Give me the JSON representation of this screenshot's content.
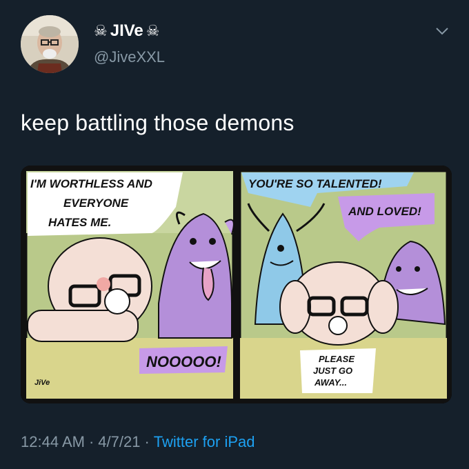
{
  "user": {
    "display_name": "JIVe",
    "name_prefix_icon": "skull-crossbones-icon",
    "name_suffix_icon": "skull-crossbones-icon",
    "handle": "@JiveXXL"
  },
  "tweet": {
    "text": "keep battling those demons"
  },
  "comic": {
    "panel1": {
      "speech_top": [
        "I'M WORTHLESS AND",
        "EVERYONE",
        "HATES ME."
      ],
      "speech_bottom": "NOOOOO!",
      "signature": "JiVe"
    },
    "panel2": {
      "speech_left": "YOU'RE SO TALENTED!",
      "speech_right": "AND LOVED!",
      "speech_bottom": [
        "PLEASE",
        "JUST GO",
        "AWAY..."
      ]
    }
  },
  "meta": {
    "time": "12:44 AM",
    "date": "4/7/21",
    "separator": "·",
    "source": "Twitter for iPad"
  },
  "colors": {
    "background": "#15202b",
    "secondary_text": "#8899a6",
    "link": "#1da1f2",
    "demon_purple": "#b48fd9",
    "demon_blue": "#8fc9e8",
    "bubble_purple": "#c79ae8",
    "bubble_blue": "#9fd3f0",
    "panel_green": "#b9c98a"
  }
}
